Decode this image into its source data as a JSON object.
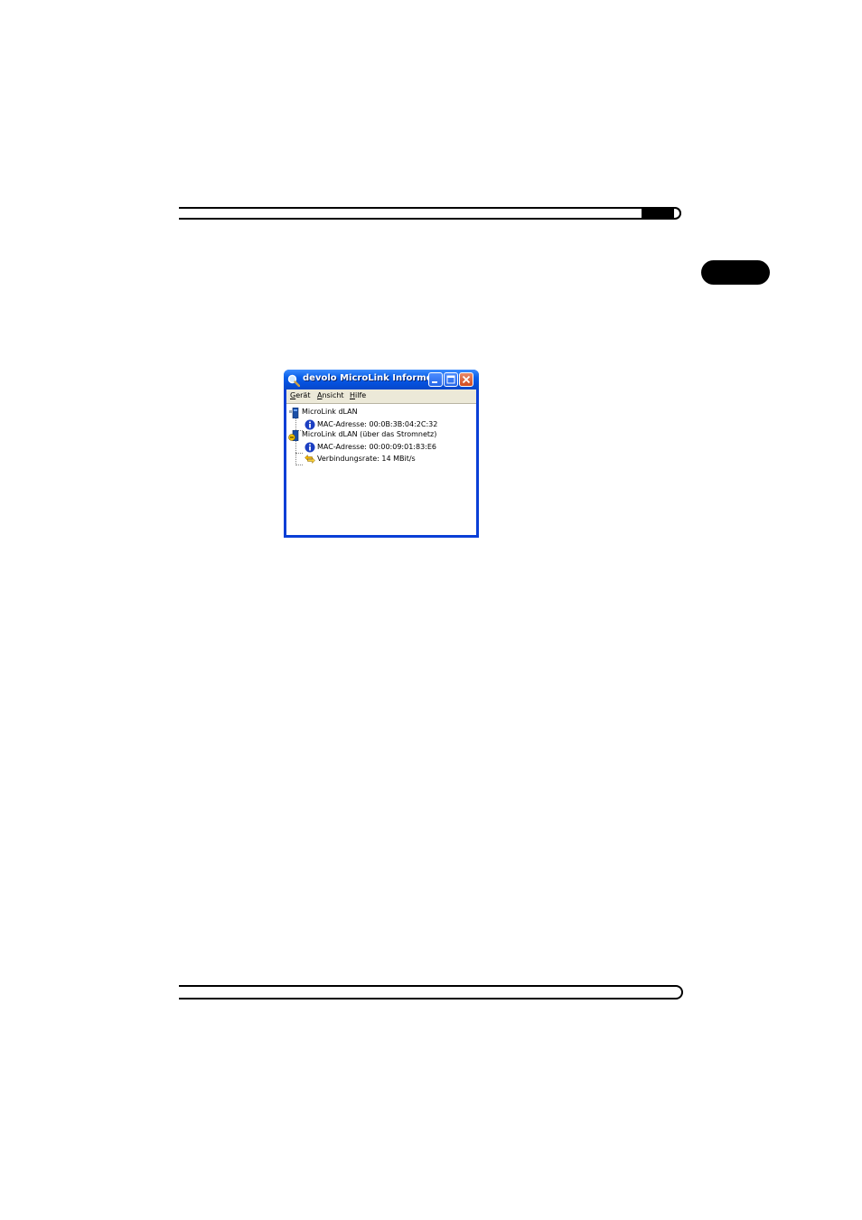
{
  "window": {
    "title": "devolo MicroLink Informer",
    "menu": [
      {
        "accel": "G",
        "rest": "erät"
      },
      {
        "accel": "A",
        "rest": "nsicht"
      },
      {
        "accel": "H",
        "rest": "ilfe"
      }
    ]
  },
  "tree": {
    "local_device": {
      "label": "MicroLink dLAN",
      "mac": "MAC-Adresse: 00:0B:3B:04:2C:32"
    },
    "remote_device": {
      "label": "MicroLink dLAN (über das Stromnetz)",
      "mac": "MAC-Adresse: 00:00:09:01:83:E6",
      "rate": "Verbindungsrate: 14 MBit/s"
    }
  },
  "colors": {
    "titlebar": "#0a5fe8",
    "frame": "#0a3fd6",
    "close_button": "#d24b1e",
    "menubar": "#ece9d8"
  },
  "icons": {
    "app": "magnifier-icon",
    "local_device": "network-adapter-icon",
    "remote_device": "powerline-adapter-icon",
    "info": "info-icon",
    "rate": "connection-arrows-icon"
  }
}
